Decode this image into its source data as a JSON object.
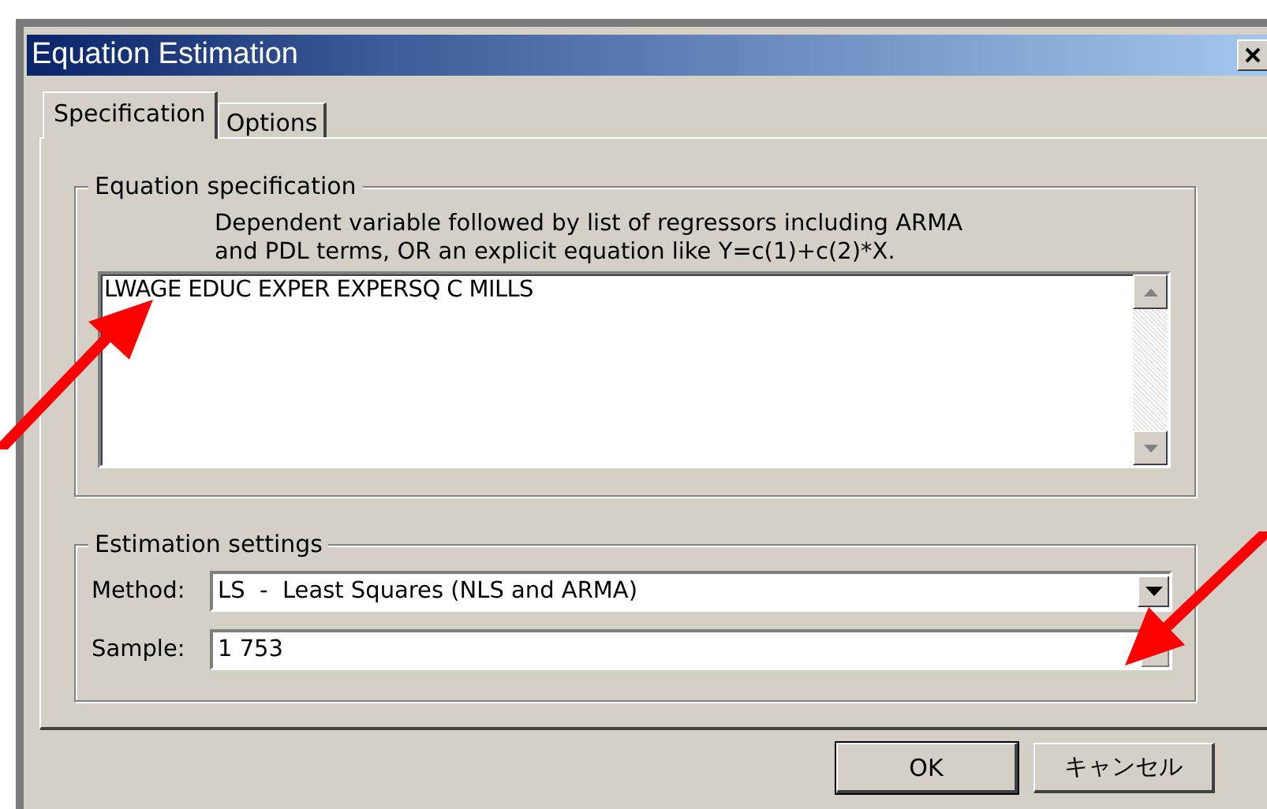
{
  "window": {
    "title": "Equation Estimation"
  },
  "tabs": [
    {
      "label": "Specification",
      "selected": true
    },
    {
      "label": "Options",
      "selected": false
    }
  ],
  "equation_specification": {
    "legend": "Equation specification",
    "hint": "Dependent variable followed by list of regressors including ARMA\nand PDL terms, OR an explicit equation like Y=c(1)+c(2)*X.",
    "value": "LWAGE EDUC EXPER EXPERSQ C MILLS"
  },
  "estimation_settings": {
    "legend": "Estimation settings",
    "method_label": "Method:",
    "method_value": "LS  -  Least Squares (NLS and ARMA)",
    "sample_label": "Sample:",
    "sample_value": "1 753"
  },
  "buttons": [
    "OK",
    "キャンセル"
  ]
}
